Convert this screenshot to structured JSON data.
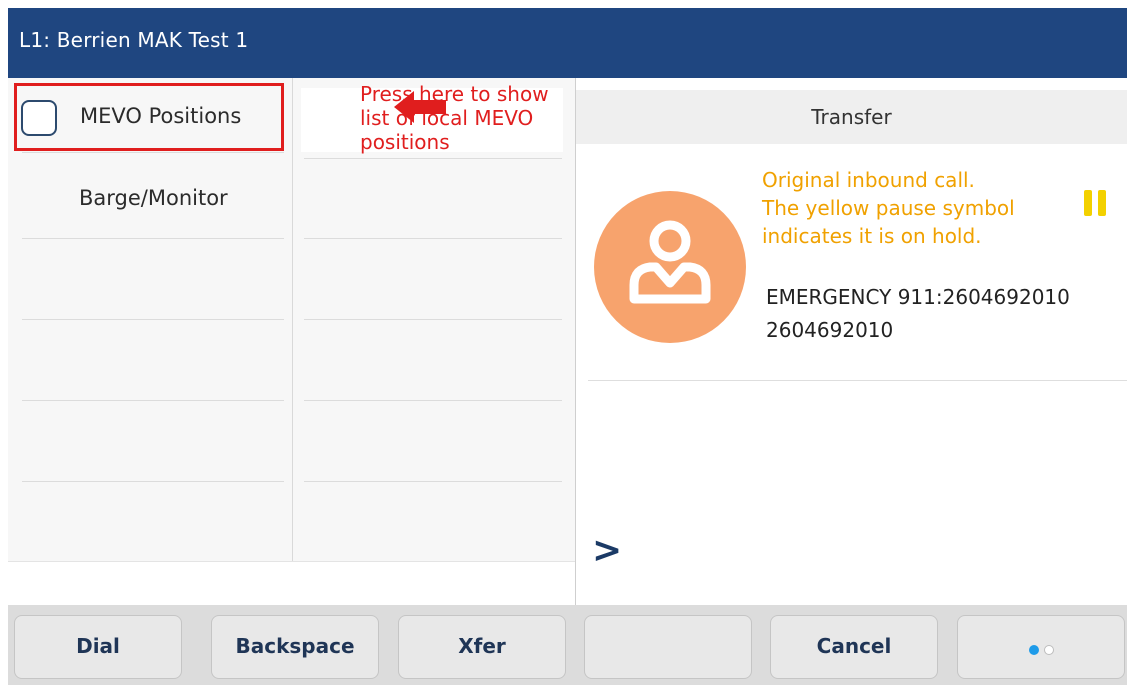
{
  "title_bar": {
    "line_label": "L1: Berrien MAK Test 1"
  },
  "left_pane": {
    "items": [
      {
        "label": "MEVO Positions"
      },
      {
        "label": "Barge/Monitor"
      }
    ],
    "annotation": {
      "text": "Press here to show list of local MEVO positions"
    }
  },
  "call_panel": {
    "header": "Transfer",
    "annotation_lines": [
      "Original inbound call.",
      "The yellow pause symbol",
      "indicates it is on hold."
    ],
    "caller_name": "EMERGENCY 911:2604692010",
    "caller_number": "2604692010",
    "expand_symbol": ">"
  },
  "softkeys": [
    {
      "label": "Dial"
    },
    {
      "label": "Backspace"
    },
    {
      "label": "Xfer"
    },
    {
      "label": ""
    },
    {
      "label": "Cancel"
    }
  ],
  "page_indicator": {
    "current": 1,
    "total": 2
  },
  "colors": {
    "title_bar": "#1f4680",
    "annotation_red": "#e01e1e",
    "annotation_orange": "#f0a100",
    "hold_yellow": "#f3d100",
    "avatar": "#f7a36d",
    "dot_active": "#1e9be9",
    "dot_inactive": "#ffffff"
  },
  "icons": {
    "avatar": "person-icon",
    "hold": "pause-icon",
    "arrow": "left-arrow-icon",
    "checkbox": "checkbox-icon",
    "expand": "chevron-right-icon"
  }
}
